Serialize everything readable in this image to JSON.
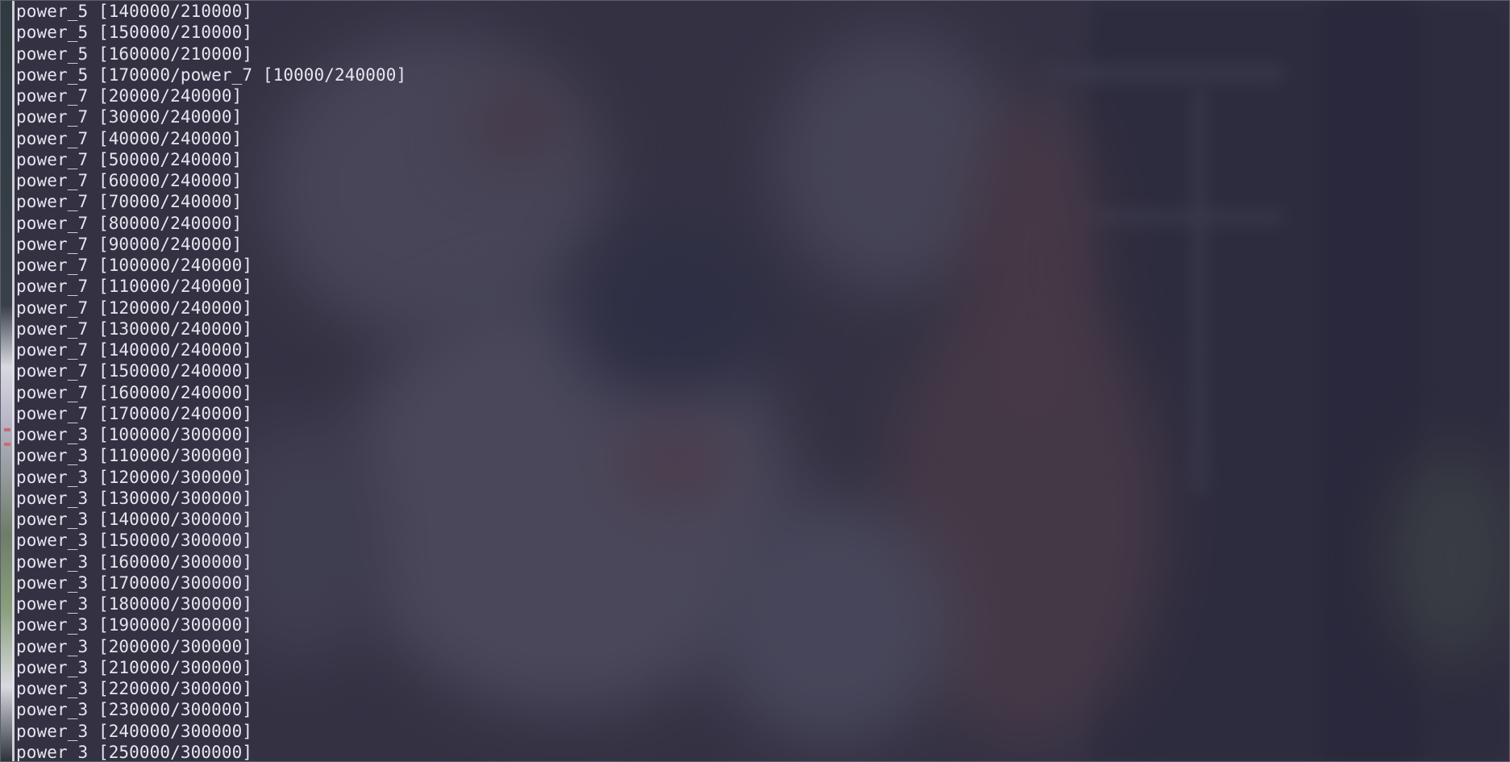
{
  "window": {
    "type": "terminal",
    "background": "#3d3c4d",
    "text_color": "#e6e6ef",
    "overlay_color": "rgba(46, 44, 62, 0.62)"
  },
  "console": {
    "lines": [
      "power_5 [140000/210000]",
      "power_5 [150000/210000]",
      "power_5 [160000/210000]",
      "power_5 [170000/power_7 [10000/240000]",
      "power_7 [20000/240000]",
      "power_7 [30000/240000]",
      "power_7 [40000/240000]",
      "power_7 [50000/240000]",
      "power_7 [60000/240000]",
      "power_7 [70000/240000]",
      "power_7 [80000/240000]",
      "power_7 [90000/240000]",
      "power_7 [100000/240000]",
      "power_7 [110000/240000]",
      "power_7 [120000/240000]",
      "power_7 [130000/240000]",
      "power_7 [140000/240000]",
      "power_7 [150000/240000]",
      "power_7 [160000/240000]",
      "power_7 [170000/240000]",
      "power_3 [100000/300000]",
      "power_3 [110000/300000]",
      "power_3 [120000/300000]",
      "power_3 [130000/300000]",
      "power_3 [140000/300000]",
      "power_3 [150000/300000]",
      "power_3 [160000/300000]",
      "power_3 [170000/300000]",
      "power_3 [180000/300000]",
      "power_3 [190000/300000]",
      "power_3 [200000/300000]",
      "power_3 [210000/300000]",
      "power_3 [220000/300000]",
      "power_3 [230000/300000]",
      "power_3 [240000/300000]",
      "power_3 [250000/300000]"
    ]
  }
}
